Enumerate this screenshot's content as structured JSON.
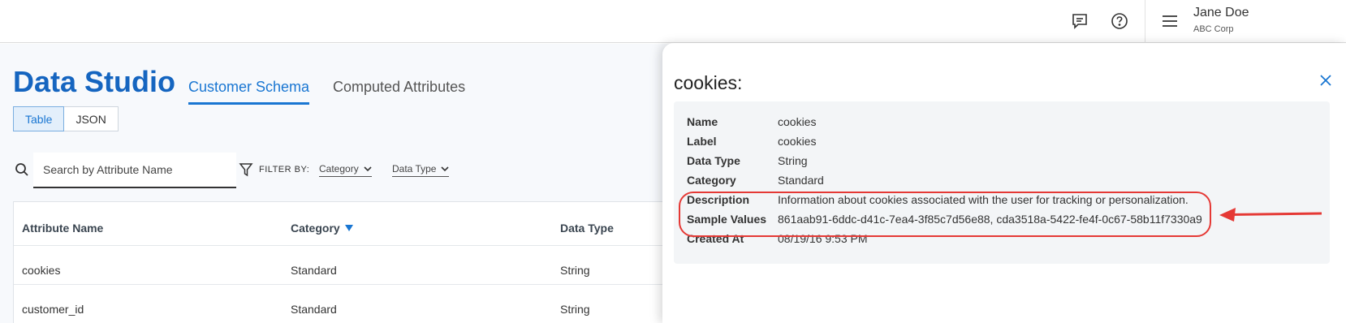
{
  "header": {
    "user_name": "Jane Doe",
    "user_org": "ABC Corp",
    "icons": [
      "chat-icon",
      "help-icon",
      "menu-icon"
    ]
  },
  "page": {
    "title": "Data Studio",
    "tabs": [
      {
        "label": "Customer Schema",
        "active": true
      },
      {
        "label": "Computed Attributes",
        "active": false
      }
    ],
    "view_toggle": [
      {
        "label": "Table",
        "active": true
      },
      {
        "label": "JSON",
        "active": false
      }
    ]
  },
  "search": {
    "placeholder": "Search by Attribute Name",
    "value": ""
  },
  "filters": {
    "label": "FILTER BY:",
    "category_label": "Category",
    "data_type_label": "Data Type"
  },
  "table": {
    "headers": {
      "attribute_name": "Attribute Name",
      "category": "Category",
      "data_type": "Data Type"
    },
    "rows": [
      {
        "attribute_name": "cookies",
        "category": "Standard",
        "data_type": "String"
      },
      {
        "attribute_name": "customer_id",
        "category": "Standard",
        "data_type": "String"
      }
    ]
  },
  "panel": {
    "title": "cookies:",
    "fields": [
      {
        "label": "Name",
        "value": "cookies"
      },
      {
        "label": "Label",
        "value": "cookies"
      },
      {
        "label": "Data Type",
        "value": "String"
      },
      {
        "label": "Category",
        "value": "Standard"
      },
      {
        "label": "Description",
        "value": "Information about cookies associated with the user for tracking or personalization."
      },
      {
        "label": "Sample Values",
        "value": "861aab91-6ddc-d41c-7ea4-3f85c7d56e88, cda3518a-5422-fe4f-0c67-58b11f7330a9"
      },
      {
        "label": "Created At",
        "value": "08/19/16 9:53 PM"
      }
    ]
  },
  "colors": {
    "brand_blue": "#1565c0",
    "accent_blue": "#1976d2",
    "annotation_red": "#e53935"
  }
}
